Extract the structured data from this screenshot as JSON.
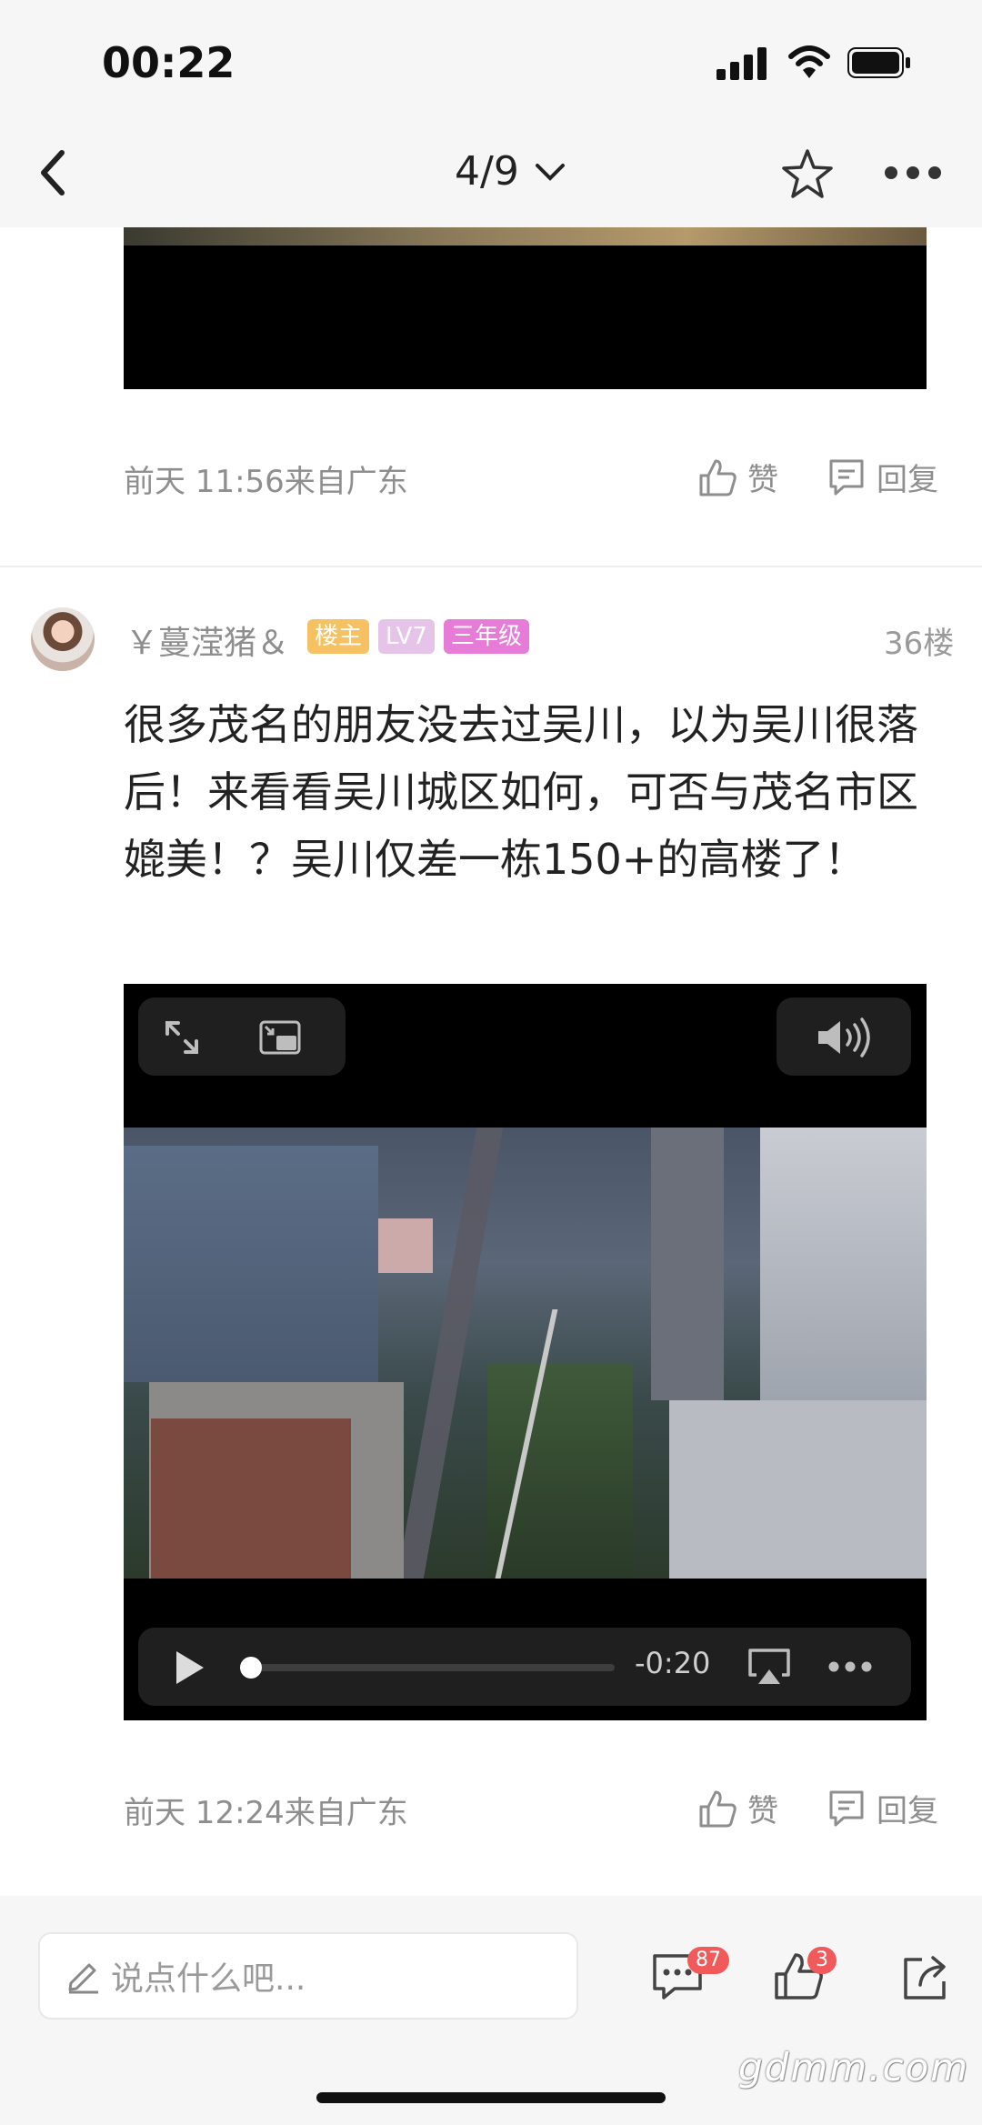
{
  "status_bar": {
    "time": "00:22"
  },
  "nav": {
    "page_indicator": "4/9"
  },
  "previous_post": {
    "timestamp": "前天 11:56来自广东",
    "like_label": "赞",
    "reply_label": "回复"
  },
  "post": {
    "username": "￥蔓滢猪＆",
    "badges": [
      {
        "text": "楼主",
        "color": "#f5c163"
      },
      {
        "text": "LV7",
        "color": "#e6c4ea"
      },
      {
        "text": "三年级",
        "color": "#e77bd8"
      }
    ],
    "floor": "36楼",
    "text": "很多茂名的朋友没去过吴川，以为吴川很落后！来看看吴川城区如何，可否与茂名市区媲美！？吴川仅差一栋150+的高楼了！",
    "video": {
      "time_remaining": "-0:20",
      "progress": 0.0
    },
    "timestamp": "前天 12:24来自广东",
    "like_label": "赞",
    "reply_label": "回复"
  },
  "bottom_bar": {
    "comment_placeholder": "说点什么吧...",
    "comment_count": "87",
    "like_count": "3"
  },
  "watermark": "gdmm.com",
  "icons": [
    "back-icon",
    "chevron-down-icon",
    "star-icon",
    "more-icon",
    "thumb-up-icon",
    "reply-icon",
    "fullscreen-icon",
    "pip-icon",
    "volume-icon",
    "play-icon",
    "airplay-icon",
    "pen-icon",
    "comment-icon",
    "share-icon"
  ]
}
